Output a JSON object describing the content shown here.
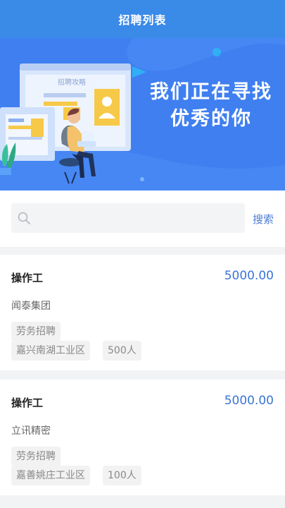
{
  "header": {
    "title": "招聘列表"
  },
  "banner": {
    "headline_line1": "我们正在寻找",
    "headline_line2": "优秀的你",
    "window_caption": "招聘攻略"
  },
  "search": {
    "placeholder": "",
    "button_label": "搜索"
  },
  "jobs": [
    {
      "title": "操作工",
      "salary": "5000.00",
      "company": "闻泰集团",
      "tags": [
        "劳务招聘",
        "嘉兴南湖工业区",
        "500人"
      ]
    },
    {
      "title": "操作工",
      "salary": "5000.00",
      "company": "立讯精密",
      "tags": [
        "劳务招聘",
        "嘉善姚庄工业区",
        "100人"
      ]
    }
  ],
  "colors": {
    "header_bg": "#3a8ae8",
    "banner_bg": "#3f7ff0",
    "accent": "#3a74d8"
  }
}
